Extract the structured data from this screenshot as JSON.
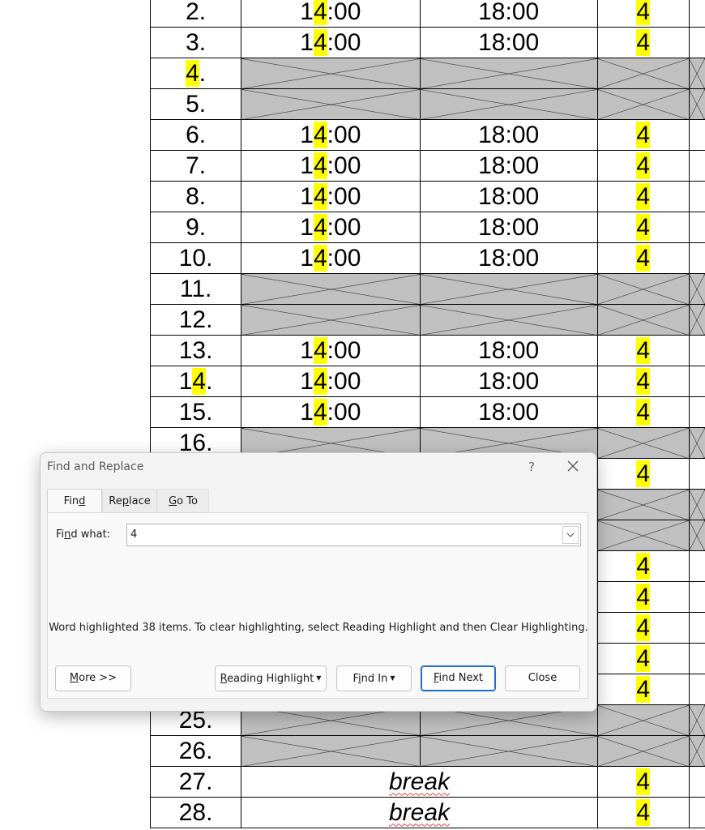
{
  "table": {
    "rows": [
      {
        "num": "2.",
        "start": "14:00",
        "end": "18:00",
        "hours": "4",
        "type": "time"
      },
      {
        "num": "3.",
        "start": "14:00",
        "end": "18:00",
        "hours": "4",
        "type": "time"
      },
      {
        "num": "4.",
        "type": "blocked"
      },
      {
        "num": "5.",
        "type": "blocked"
      },
      {
        "num": "6.",
        "start": "14:00",
        "end": "18:00",
        "hours": "4",
        "type": "time"
      },
      {
        "num": "7.",
        "start": "14:00",
        "end": "18:00",
        "hours": "4",
        "type": "time"
      },
      {
        "num": "8.",
        "start": "14:00",
        "end": "18:00",
        "hours": "4",
        "type": "time"
      },
      {
        "num": "9.",
        "start": "14:00",
        "end": "18:00",
        "hours": "4",
        "type": "time"
      },
      {
        "num": "10.",
        "start": "14:00",
        "end": "18:00",
        "hours": "4",
        "type": "time"
      },
      {
        "num": "11.",
        "type": "blocked"
      },
      {
        "num": "12.",
        "type": "blocked"
      },
      {
        "num": "13.",
        "start": "14:00",
        "end": "18:00",
        "hours": "4",
        "type": "time"
      },
      {
        "num": "14.",
        "start": "14:00",
        "end": "18:00",
        "hours": "4",
        "type": "time"
      },
      {
        "num": "15.",
        "start": "14:00",
        "end": "18:00",
        "hours": "4",
        "type": "time"
      },
      {
        "num": "16.",
        "type": "blocked"
      },
      {
        "num": "",
        "hours": "4",
        "type": "hidden-hours"
      },
      {
        "num": "",
        "type": "blocked-right"
      },
      {
        "num": "",
        "type": "blocked-right"
      },
      {
        "num": "",
        "hours": "4",
        "type": "hidden-hours"
      },
      {
        "num": "",
        "hours": "4",
        "type": "hidden-hours"
      },
      {
        "num": "",
        "hours": "4",
        "type": "hidden-hours"
      },
      {
        "num": "",
        "hours": "4",
        "type": "hidden-hours"
      },
      {
        "num": "",
        "hours": "4",
        "type": "hidden-hours"
      },
      {
        "num": "25.",
        "type": "blocked"
      },
      {
        "num": "26.",
        "type": "blocked"
      },
      {
        "num": "27.",
        "merged": "break",
        "hours": "4",
        "type": "break"
      },
      {
        "num": "28.",
        "merged": "break",
        "hours": "4",
        "type": "break"
      }
    ],
    "highlight_char": "4",
    "highlight_color": "#ffff00"
  },
  "dialog": {
    "title": "Find and Replace",
    "help": "?",
    "tabs": [
      {
        "label": "Find",
        "mnemonic_index": 3
      },
      {
        "label": "Replace",
        "mnemonic_index": 2
      },
      {
        "label": "Go To",
        "mnemonic_index": 0
      }
    ],
    "find_label": "Find what:",
    "find_value": "4",
    "status": "Word highlighted 38 items. To clear highlighting, select Reading Highlight and then Clear Highlighting.",
    "buttons": {
      "more": "More >>",
      "reading_highlight": "Reading Highlight",
      "find_in": "Find In",
      "find_next": "Find Next",
      "close": "Close"
    },
    "accent_color": "#1f6fc4"
  }
}
